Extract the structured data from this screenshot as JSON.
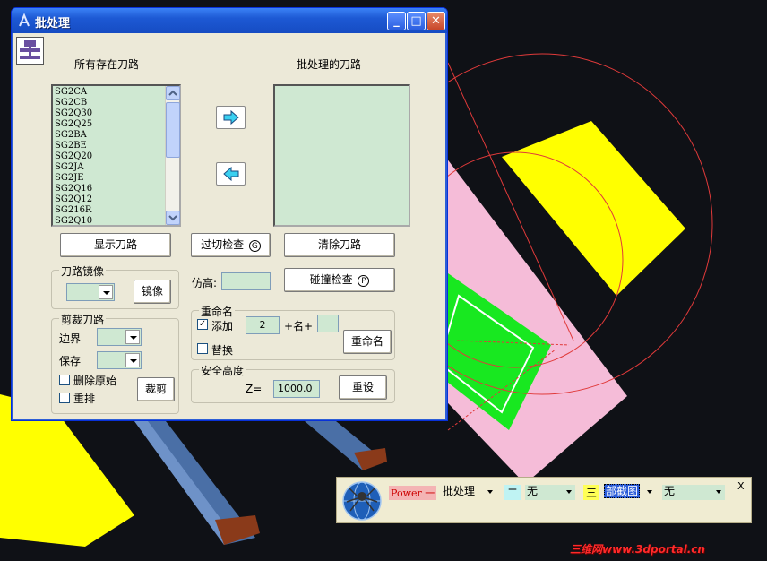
{
  "window": {
    "title": "批处理",
    "min": "_",
    "max": "□",
    "close": "✕"
  },
  "headers": {
    "left": "所有存在刀路",
    "right": "批处理的刀路"
  },
  "toolpaths": [
    "SG2CA",
    "SG2CB",
    "SG2Q30",
    "SG2Q25",
    "SG2BA",
    "SG2BE",
    "SG2Q20",
    "SG2JA",
    "SG2JE",
    "SG2Q16",
    "SG2Q12",
    "SG216R",
    "SG2Q10"
  ],
  "buttons": {
    "show_path": "显示刀路",
    "overcut_check": "过切检查",
    "overcut_key": "G",
    "clear_path": "清除刀路",
    "mirror": "镜像",
    "collision_check": "碰撞检查",
    "collision_key": "P",
    "rename": "重命名",
    "cut": "裁剪",
    "reset": "重设"
  },
  "mirror_group": {
    "title": "刀路镜像"
  },
  "cut_group": {
    "title": "剪裁刀路",
    "boundary_label": "边界",
    "save_label": "保存",
    "delete_original": "删除原始",
    "reorder": "重排"
  },
  "imitate": {
    "label": "仿高:"
  },
  "rename_group": {
    "title": "重命名",
    "add_label": "添加",
    "add_checked": true,
    "number": "2",
    "plus_name": "+名+",
    "replace_label": "替换"
  },
  "safety": {
    "title": "安全高度",
    "z_label": "Z=",
    "z_value": "1000.0"
  },
  "toolbar": {
    "label1": "Power 一",
    "combo1": "批处理",
    "label2": "二",
    "combo2": "无",
    "label3": "三",
    "combo3": "部截图",
    "combo4": "无",
    "close": "X"
  },
  "watermark": "三维网www.3dportal.cn"
}
